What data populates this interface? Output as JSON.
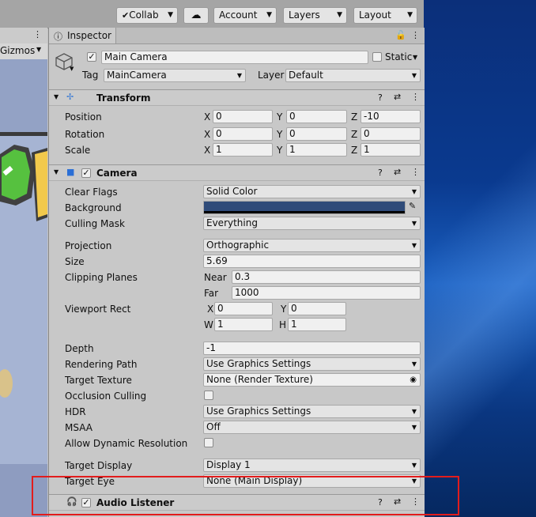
{
  "toolbar": {
    "collab": "Collab",
    "account": "Account",
    "layers": "Layers",
    "layout": "Layout"
  },
  "scene": {
    "gizmos": "Gizmos"
  },
  "inspector": {
    "tab_title": "Inspector",
    "object_name": "Main Camera",
    "static_label": "Static",
    "tag_label": "Tag",
    "tag_value": "MainCamera",
    "layer_label": "Layer",
    "layer_value": "Default",
    "transform": {
      "title": "Transform",
      "position_label": "Position",
      "rotation_label": "Rotation",
      "scale_label": "Scale",
      "x": "X",
      "y": "Y",
      "z": "Z",
      "position": [
        "0",
        "0",
        "-10"
      ],
      "rotation": [
        "0",
        "0",
        "0"
      ],
      "scale": [
        "1",
        "1",
        "1"
      ]
    },
    "camera": {
      "title": "Camera",
      "clear_flags_label": "Clear Flags",
      "clear_flags": "Solid Color",
      "background_label": "Background",
      "background_color": "#2f4b79",
      "culling_mask_label": "Culling Mask",
      "culling_mask": "Everything",
      "projection_label": "Projection",
      "projection": "Orthographic",
      "size_label": "Size",
      "size": "5.69",
      "clipping_label": "Clipping Planes",
      "near_label": "Near",
      "near": "0.3",
      "far_label": "Far",
      "far": "1000",
      "viewport_label": "Viewport Rect",
      "vp_x_label": "X",
      "vp_x": "0",
      "vp_y_label": "Y",
      "vp_y": "0",
      "vp_w_label": "W",
      "vp_w": "1",
      "vp_h_label": "H",
      "vp_h": "1",
      "depth_label": "Depth",
      "depth": "-1",
      "rendering_path_label": "Rendering Path",
      "rendering_path": "Use Graphics Settings",
      "target_texture_label": "Target Texture",
      "target_texture": "None (Render Texture)",
      "occlusion_label": "Occlusion Culling",
      "hdr_label": "HDR",
      "hdr": "Use Graphics Settings",
      "msaa_label": "MSAA",
      "msaa": "Off",
      "dyn_res_label": "Allow Dynamic Resolution",
      "target_display_label": "Target Display",
      "target_display": "Display 1",
      "target_eye_label": "Target Eye",
      "target_eye": "None (Main Display)"
    },
    "audio_listener": {
      "title": "Audio Listener"
    }
  }
}
